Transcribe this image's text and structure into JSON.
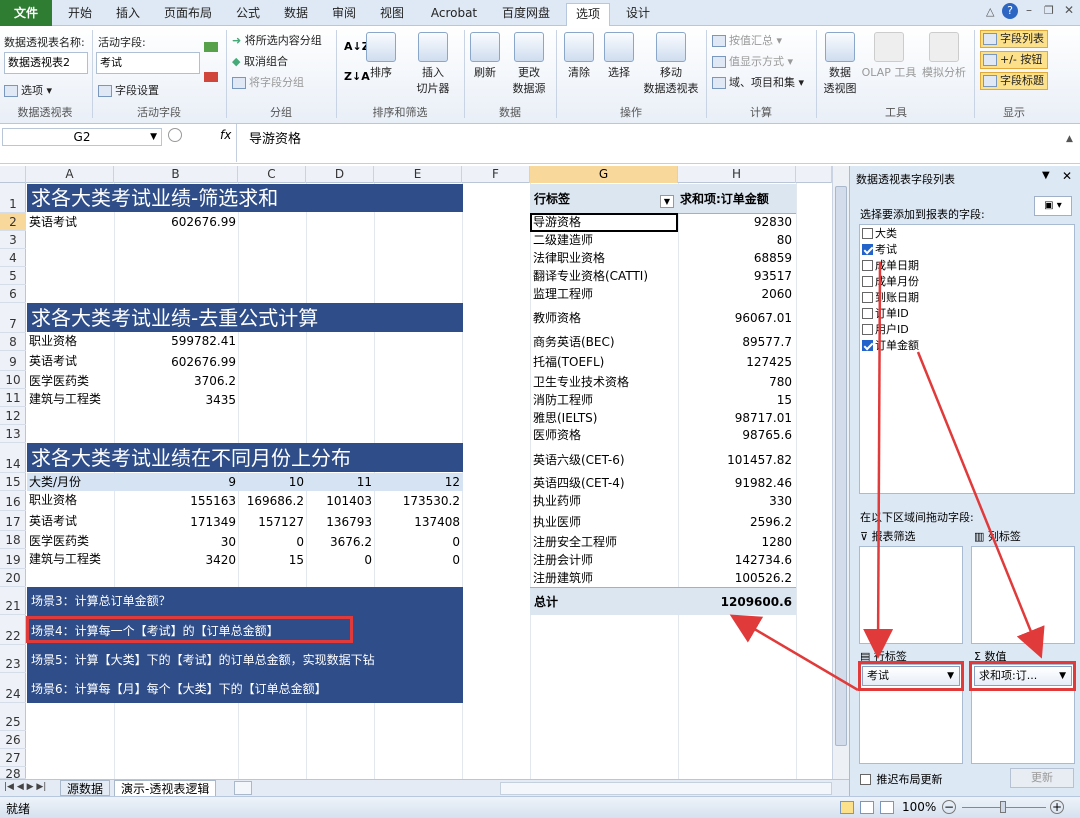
{
  "tabs": [
    "文件",
    "开始",
    "插入",
    "页面布局",
    "公式",
    "数据",
    "审阅",
    "视图",
    "Acrobat",
    "百度网盘",
    "选项",
    "设计"
  ],
  "ribbon": {
    "pivot_name_label": "数据透视表名称:",
    "pivot_name_value": "数据透视表2",
    "options_label": "选项",
    "group_pivot": "数据透视表",
    "active_field_label": "活动字段:",
    "active_field_value": "考试",
    "field_settings": "字段设置",
    "group_active": "活动字段",
    "group_sel": "将所选内容分组",
    "ungroup": "取消组合",
    "group_field": "将字段分组",
    "group_group": "分组",
    "sort": "排序",
    "group_sort": "排序和筛选",
    "slicer": "插入\n切片器",
    "refresh": "刷新",
    "change_source": "更改\n数据源",
    "group_data": "数据",
    "clear": "清除",
    "select": "选择",
    "move_pivot": "移动\n数据透视表",
    "group_ops": "操作",
    "summarize_by": "按值汇总",
    "show_values_as": "值显示方式",
    "fields_items": "域、项目和集",
    "group_calc": "计算",
    "pivot_chart": "数据\n透视图",
    "olap": "OLAP 工具",
    "whatif": "模拟分析",
    "group_tools": "工具",
    "field_list": "字段列表",
    "buttons": "+/- 按钮",
    "field_headers": "字段标题",
    "group_show": "显示"
  },
  "formula_bar": {
    "name_box": "G2",
    "fx": "fx",
    "content": "导游资格"
  },
  "columns": [
    "A",
    "B",
    "C",
    "D",
    "E",
    "F",
    "G",
    "H"
  ],
  "rows": [
    "1",
    "2",
    "3",
    "4",
    "5",
    "6",
    "7",
    "8",
    "9",
    "10",
    "11",
    "12",
    "13",
    "14",
    "15",
    "16",
    "17",
    "18",
    "19",
    "20",
    "21",
    "22",
    "23",
    "24",
    "25",
    "26",
    "27",
    "28"
  ],
  "sheet": {
    "b1": "求各大类考试业绩-筛选求和",
    "r2": [
      "英语考试",
      "602676.99"
    ],
    "b2": "求各大类考试业绩-去重公式计算",
    "t2": [
      [
        "职业资格",
        "599782.41"
      ],
      [
        "英语考试",
        "602676.99"
      ],
      [
        "医学医药类",
        "3706.2"
      ],
      [
        "建筑与工程类",
        "3435"
      ]
    ],
    "b3": "求各大类考试业绩在不同月份上分布",
    "t3_header": [
      "大类/月份",
      "9",
      "10",
      "11",
      "12"
    ],
    "t3": [
      [
        "职业资格",
        "155163",
        "169686.2",
        "101403",
        "173530.2"
      ],
      [
        "英语考试",
        "171349",
        "157127",
        "136793",
        "137408"
      ],
      [
        "医学医药类",
        "30",
        "0",
        "3676.2",
        "0"
      ],
      [
        "建筑与工程类",
        "3420",
        "15",
        "0",
        "0"
      ]
    ],
    "scenes": [
      "场景3：计算总订单金额？",
      "场景4：计算每一个【考试】的【订单总金额】",
      "场景5：计算【大类】下的【考试】的订单总金额，实现数据下钻",
      "场景6：计算每【月】每个【大类】下的【订单总金额】"
    ]
  },
  "pivot": {
    "row_label": "行标签",
    "sum_label": "求和项:订单金额",
    "rows": [
      [
        "导游资格",
        "92830"
      ],
      [
        "二级建造师",
        "80"
      ],
      [
        "法律职业资格",
        "68859"
      ],
      [
        "翻译专业资格(CATTI)",
        "93517"
      ],
      [
        "监理工程师",
        "2060"
      ],
      [
        "教师资格",
        "96067.01"
      ],
      [
        "商务英语(BEC)",
        "89577.7"
      ],
      [
        "托福(TOEFL)",
        "127425"
      ],
      [
        "卫生专业技术资格",
        "780"
      ],
      [
        "消防工程师",
        "15"
      ],
      [
        "雅思(IELTS)",
        "98717.01"
      ],
      [
        "医师资格",
        "98765.6"
      ],
      [
        "英语六级(CET-6)",
        "101457.82"
      ],
      [
        "英语四级(CET-4)",
        "91982.46"
      ],
      [
        "执业药师",
        "330"
      ],
      [
        "执业医师",
        "2596.2"
      ],
      [
        "注册安全工程师",
        "1280"
      ],
      [
        "注册会计师",
        "142734.6"
      ],
      [
        "注册建筑师",
        "100526.2"
      ]
    ],
    "total_label": "总计",
    "total_value": "1209600.6"
  },
  "panel": {
    "title": "数据透视表字段列表",
    "choose": "选择要添加到报表的字段:",
    "fields": [
      {
        "name": "大类",
        "checked": false
      },
      {
        "name": "考试",
        "checked": true
      },
      {
        "name": "成单日期",
        "checked": false
      },
      {
        "name": "成单月份",
        "checked": false
      },
      {
        "name": "到账日期",
        "checked": false
      },
      {
        "name": "订单ID",
        "checked": false
      },
      {
        "name": "用户ID",
        "checked": false
      },
      {
        "name": "订单金额",
        "checked": true
      }
    ],
    "drag_label": "在以下区域间拖动字段:",
    "filter": "报表筛选",
    "cols": "列标签",
    "rows": "行标签",
    "values": "数值",
    "row_item": "考试",
    "value_item": "求和项:订...",
    "defer": "推迟布局更新",
    "update": "更新"
  },
  "sheet_tabs": [
    "源数据",
    "演示-透视表逻辑"
  ],
  "status": {
    "ready": "就绪",
    "zoom": "100%"
  }
}
